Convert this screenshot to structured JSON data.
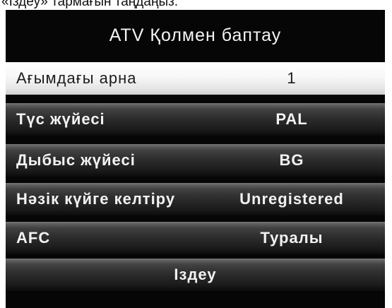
{
  "caption": "«Іздеу» тармағын таңдаңыз.",
  "menu": {
    "title": "ATV Қолмен баптау",
    "items": [
      {
        "label": "Ағымдағы арна",
        "value": "1"
      },
      {
        "label": "Түс жүйесі",
        "value": "PAL"
      },
      {
        "label": "Дыбыс жүйесі",
        "value": "BG"
      },
      {
        "label": "Нәзік күйге келтіру",
        "value": "Unregistered"
      },
      {
        "label": "AFC",
        "value": "Туралы"
      },
      {
        "label": "Іздеу"
      }
    ]
  }
}
